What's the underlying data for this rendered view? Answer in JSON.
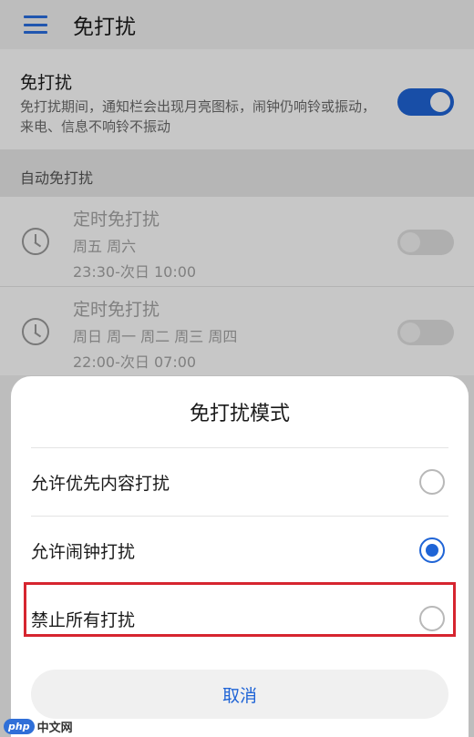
{
  "appbar": {
    "title": "免打扰"
  },
  "dnd": {
    "title": "免打扰",
    "description": "免打扰期间，通知栏会出现月亮图标，闹钟仍响铃或振动，来电、信息不响铃不振动",
    "enabled": true
  },
  "auto_section": {
    "header": "自动免打扰"
  },
  "schedules": [
    {
      "title": "定时免打扰",
      "days": "周五 周六",
      "time": "23:30-次日 10:00",
      "enabled": false
    },
    {
      "title": "定时免打扰",
      "days": "周日 周一 周二 周三 周四",
      "time": "22:00-次日 07:00",
      "enabled": false
    }
  ],
  "dialog": {
    "title": "免打扰模式",
    "options": [
      {
        "label": "允许优先内容打扰",
        "selected": false
      },
      {
        "label": "允许闹钟打扰",
        "selected": true
      },
      {
        "label": "禁止所有打扰",
        "selected": false
      }
    ],
    "cancel_label": "取消"
  },
  "watermark": {
    "logo": "php",
    "text": "中文网"
  },
  "colors": {
    "accent": "#1f64d6",
    "highlight": "#d6252f"
  }
}
